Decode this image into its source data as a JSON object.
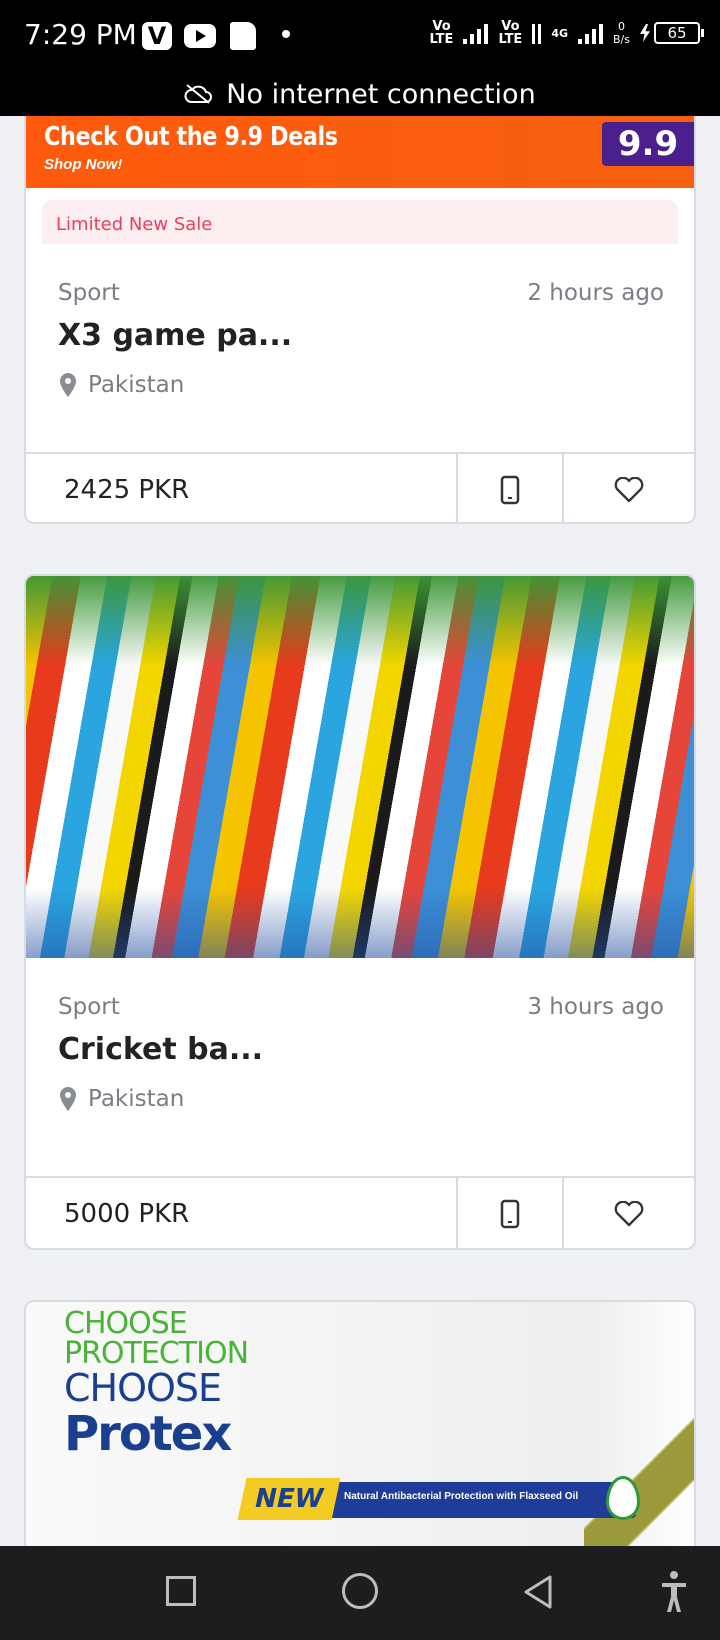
{
  "status_bar": {
    "time": "7:29 PM",
    "v_icon": "V",
    "net1": "Vo\nLTE",
    "net2": "Vo\nLTE",
    "net3": "4G",
    "speed_value": "0",
    "speed_unit": "B/s",
    "battery": "65",
    "icons": [
      "v-app-icon",
      "youtube-icon",
      "sim-icon",
      "dot-icon",
      "signal-icon",
      "battery-charging-icon"
    ]
  },
  "offline_banner": {
    "text": "No internet connection",
    "icon": "cloud-off-icon"
  },
  "listings": [
    {
      "promo_title": "Check Out the 9.9 Deals",
      "promo_subtitle": "Shop Now!",
      "promo_badge": "9.9",
      "sale_label": "Limited New Sale",
      "category": "Sport",
      "posted": "2 hours ago",
      "title": "X3 game pa...",
      "location": "Pakistan",
      "price": "2425 PKR"
    },
    {
      "category": "Sport",
      "posted": "3 hours ago",
      "title": "Cricket ba...",
      "location": "Pakistan",
      "price": "5000 PKR"
    }
  ],
  "ad": {
    "line1": "CHOOSE",
    "line2": "PROTECTION",
    "line3": "CHOOSE",
    "brand": "Protex",
    "new_badge": "NEW",
    "tagline": "Natural Antibacterial Protection with Flaxseed Oil"
  },
  "colors": {
    "accent_orange": "#ff5a0d",
    "sale_red": "#e8405e",
    "brand_purple": "#4b1f8c"
  },
  "nav_bar": {
    "icons": [
      "recents-square-icon",
      "home-circle-icon",
      "back-triangle-icon",
      "accessibility-icon"
    ]
  }
}
